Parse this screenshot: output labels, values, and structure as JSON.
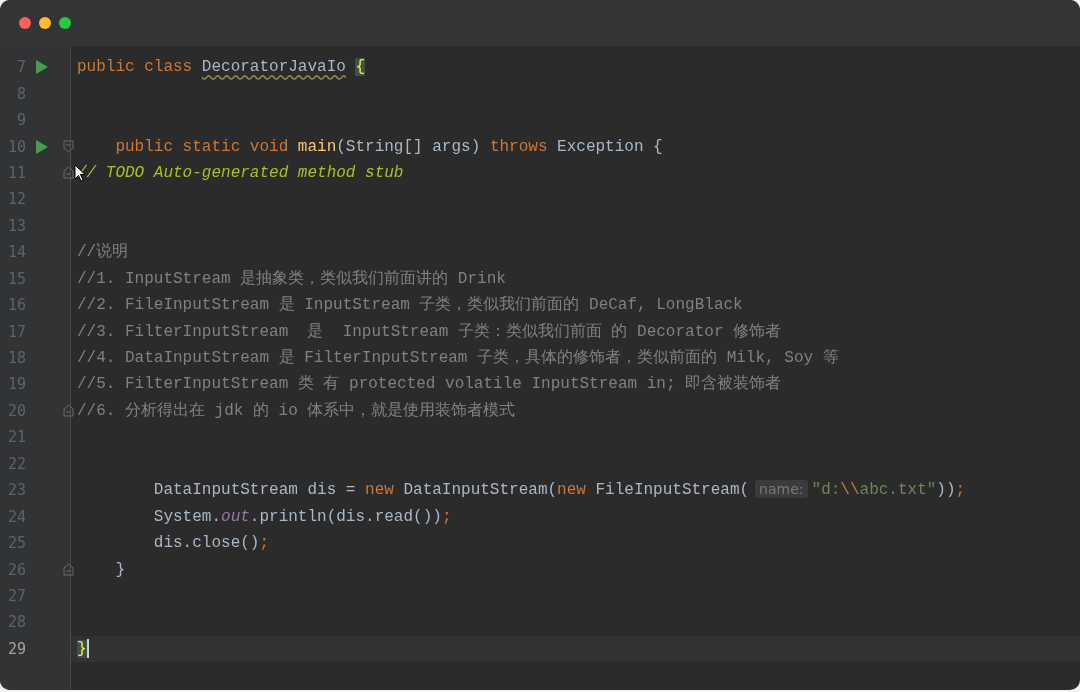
{
  "window": {
    "traffic_lights": [
      {
        "color": "#ff5f57"
      },
      {
        "color": "#febc2e"
      },
      {
        "color": "#28c840"
      }
    ]
  },
  "editor": {
    "lines": [
      {
        "number": "7",
        "run": true,
        "current": false,
        "tokens": [
          {
            "kind": "keyword",
            "text": "public class "
          },
          {
            "kind": "classname",
            "text": "DecoratorJavaIo"
          },
          {
            "kind": "brace",
            "text": "{"
          }
        ]
      },
      {
        "number": "8",
        "run": false,
        "current": false
      },
      {
        "number": "9",
        "run": false,
        "current": false
      },
      {
        "number": "10",
        "run": true,
        "fold_start": true,
        "current": false,
        "tokens": [
          {
            "kind": "keyword",
            "text": "    public static void "
          },
          {
            "kind": "method",
            "text": "main"
          },
          {
            "kind": "plain",
            "text": "(String[] args) "
          },
          {
            "kind": "keyword",
            "text": "throws "
          },
          {
            "kind": "plain",
            "text": "Exception {"
          }
        ]
      },
      {
        "number": "11",
        "run": false,
        "fold_end": true,
        "pointer": true,
        "current": false,
        "tokens": [
          {
            "kind": "todo",
            "text": "// TODO Auto-generated method stub"
          }
        ]
      },
      {
        "number": "12",
        "run": false,
        "current": false
      },
      {
        "number": "13",
        "run": false,
        "current": false
      },
      {
        "number": "14",
        "run": false,
        "current": false,
        "tokens": [
          {
            "kind": "comment",
            "text": "//说明"
          }
        ]
      },
      {
        "number": "15",
        "run": false,
        "current": false,
        "tokens": [
          {
            "kind": "comment",
            "text": "//1. InputStream 是抽象类，类似我们前面讲的 Drink"
          }
        ]
      },
      {
        "number": "16",
        "run": false,
        "current": false,
        "tokens": [
          {
            "kind": "comment",
            "text": "//2. FileInputStream 是 InputStream 子类，类似我们前面的 DeCaf, LongBlack"
          }
        ]
      },
      {
        "number": "17",
        "run": false,
        "current": false,
        "tokens": [
          {
            "kind": "comment",
            "text": "//3. FilterInputStream  是  InputStream 子类：类似我们前面 的 Decorator 修饰者"
          }
        ]
      },
      {
        "number": "18",
        "run": false,
        "current": false,
        "tokens": [
          {
            "kind": "comment",
            "text": "//4. DataInputStream 是 FilterInputStream 子类，具体的修饰者，类似前面的 Milk, Soy 等"
          }
        ]
      },
      {
        "number": "19",
        "run": false,
        "current": false,
        "tokens": [
          {
            "kind": "comment",
            "text": "//5. FilterInputStream 类 有 protected volatile InputStream in; 即含被装饰者"
          }
        ]
      },
      {
        "number": "20",
        "run": false,
        "fold_end": true,
        "current": false,
        "tokens": [
          {
            "kind": "comment",
            "text": "//6. 分析得出在 jdk 的 io 体系中，就是使用装饰者模式"
          }
        ]
      },
      {
        "number": "21",
        "run": false,
        "current": false
      },
      {
        "number": "22",
        "run": false,
        "current": false
      },
      {
        "number": "23",
        "run": false,
        "current": false,
        "tokens": [
          {
            "kind": "plain",
            "text": "        DataInputStream dis = "
          },
          {
            "kind": "keyword",
            "text": "new "
          },
          {
            "kind": "plain",
            "text": "DataInputStream("
          },
          {
            "kind": "keyword",
            "text": "new "
          },
          {
            "kind": "plain",
            "text": "FileInputStream("
          },
          {
            "kind": "hint",
            "text": "name:"
          },
          {
            "kind": "string",
            "text": "\"d:"
          },
          {
            "kind": "escape",
            "text": "\\\\"
          },
          {
            "kind": "string",
            "text": "abc.txt\""
          },
          {
            "kind": "plain",
            "text": "))"
          },
          {
            "kind": "keyword",
            "text": ";"
          }
        ]
      },
      {
        "number": "24",
        "run": false,
        "current": false,
        "tokens": [
          {
            "kind": "plain",
            "text": "        System."
          },
          {
            "kind": "static",
            "text": "out"
          },
          {
            "kind": "plain",
            "text": ".println(dis.read())"
          },
          {
            "kind": "keyword",
            "text": ";"
          }
        ]
      },
      {
        "number": "25",
        "run": false,
        "current": false,
        "tokens": [
          {
            "kind": "plain",
            "text": "        dis.close()"
          },
          {
            "kind": "keyword",
            "text": ";"
          }
        ]
      },
      {
        "number": "26",
        "run": false,
        "fold_end": true,
        "current": false,
        "tokens": [
          {
            "kind": "plain",
            "text": "    }"
          }
        ]
      },
      {
        "number": "27",
        "run": false,
        "current": false
      },
      {
        "number": "28",
        "run": false,
        "current": false
      },
      {
        "number": "29",
        "run": false,
        "current": true,
        "tokens": [
          {
            "kind": "brace",
            "text": "}"
          }
        ]
      }
    ]
  }
}
